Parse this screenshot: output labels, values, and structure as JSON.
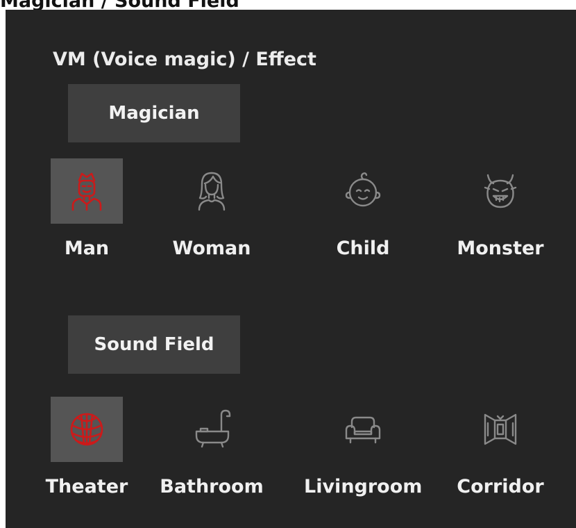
{
  "page": {
    "heading": "Magician / Sound Field"
  },
  "panel": {
    "title": "VM (Voice magic) / Effect"
  },
  "sections": {
    "magician": {
      "label": "Magician",
      "options": [
        {
          "label": "Man",
          "icon": "man-icon",
          "selected": true
        },
        {
          "label": "Woman",
          "icon": "woman-icon",
          "selected": false
        },
        {
          "label": "Child",
          "icon": "child-icon",
          "selected": false
        },
        {
          "label": "Monster",
          "icon": "monster-icon",
          "selected": false
        }
      ]
    },
    "sound_field": {
      "label": "Sound Field",
      "options": [
        {
          "label": "Theater",
          "icon": "theater-icon",
          "selected": true
        },
        {
          "label": "Bathroom",
          "icon": "bathtub-icon",
          "selected": false
        },
        {
          "label": "Livingroom",
          "icon": "sofa-icon",
          "selected": false
        },
        {
          "label": "Corridor",
          "icon": "corridor-icon",
          "selected": false
        }
      ]
    }
  },
  "colors": {
    "panel_background": "#252525",
    "button_background": "#3f3f3f",
    "selected_background": "#555555",
    "selected_icon": "#cc1a1a",
    "unselected_icon": "#8a8a8a",
    "text": "#f0f0f0"
  }
}
